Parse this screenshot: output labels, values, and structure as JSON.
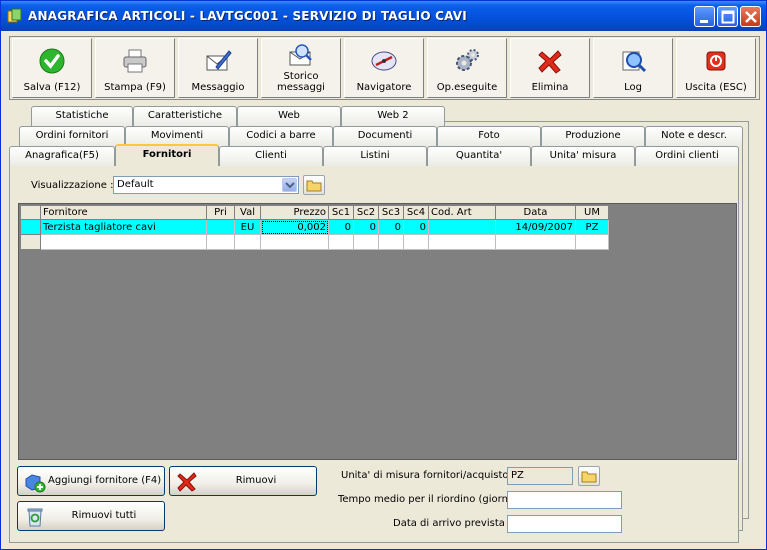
{
  "window": {
    "title": "ANAGRAFICA ARTICOLI - LAVTGC001 - SERVIZIO DI TAGLIO CAVI"
  },
  "toolbar": [
    {
      "id": "save",
      "label": "Salva (F12)",
      "icon": "check-icon"
    },
    {
      "id": "print",
      "label": "Stampa (F9)",
      "icon": "printer-icon"
    },
    {
      "id": "message",
      "label": "Messaggio",
      "icon": "pen-envelope-icon"
    },
    {
      "id": "history",
      "label": "Storico\nmessaggi",
      "icon": "search-envelope-icon"
    },
    {
      "id": "navigator",
      "label": "Navigatore",
      "icon": "compass-icon"
    },
    {
      "id": "operations",
      "label": "Op.eseguite",
      "icon": "gears-icon"
    },
    {
      "id": "delete",
      "label": "Elimina",
      "icon": "red-x-icon"
    },
    {
      "id": "log",
      "label": "Log",
      "icon": "magnifier-icon"
    },
    {
      "id": "exit",
      "label": "Uscita (ESC)",
      "icon": "power-icon"
    }
  ],
  "tabs": {
    "row1": [
      "Statistiche",
      "Caratteristiche",
      "Web",
      "Web 2"
    ],
    "row2": [
      "Ordini fornitori",
      "Movimenti",
      "Codici a barre",
      "Documenti",
      "Foto",
      "Produzione",
      "Note e descr."
    ],
    "row3": [
      "Anagrafica(F5)",
      "Fornitori",
      "Clienti",
      "Listini",
      "Quantita'",
      "Unita' misura",
      "Ordini clienti"
    ],
    "active": "Fornitori"
  },
  "view": {
    "label": "Visualizzazione :",
    "value": "Default"
  },
  "grid": {
    "columns": [
      "Fornitore",
      "Pri",
      "Val",
      "Prezzo",
      "Sc1",
      "Sc2",
      "Sc3",
      "Sc4",
      "Cod. Art",
      "Data",
      "UM"
    ],
    "rows": [
      {
        "fornitore": "Terzista tagliatore cavi",
        "pri": "",
        "val": "EU",
        "prezzo": "0,002",
        "sc1": "0",
        "sc2": "0",
        "sc3": "0",
        "sc4": "0",
        "codart": "",
        "data": "14/09/2007",
        "um": "PZ"
      }
    ]
  },
  "buttons": {
    "add_supplier": "Aggiungi fornitore (F4)",
    "remove": "Rimuovi",
    "remove_all": "Rimuovi tutti"
  },
  "fields": {
    "uom_label": "Unita' di misura fornitori/acquisto :",
    "uom_value": "PZ",
    "lead_time_label": "Tempo medio per il riordino (giorni) :",
    "lead_time_value": "",
    "arrival_label": "Data di arrivo prevista :",
    "arrival_value": ""
  }
}
